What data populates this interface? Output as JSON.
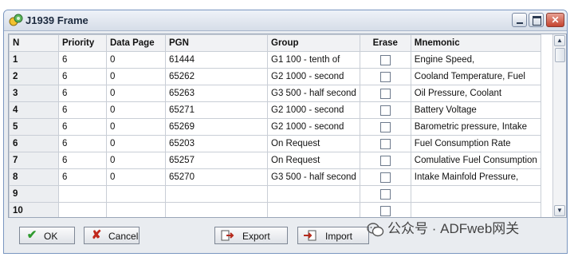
{
  "window": {
    "title": "J1939 Frame",
    "buttons": {
      "minimize": "minimize",
      "maximize": "maximize",
      "close": "✕"
    }
  },
  "grid": {
    "headers": [
      "N",
      "Priority",
      "Data Page",
      "PGN",
      "Group",
      "Erase",
      "Mnemonic"
    ],
    "rows": [
      [
        "1",
        "6",
        "0",
        "61444",
        "G1 100 - tenth of",
        "",
        "Engine Speed,"
      ],
      [
        "2",
        "6",
        "0",
        "65262",
        "G2 1000 - second",
        "",
        "Cooland Temperature, Fuel"
      ],
      [
        "3",
        "6",
        "0",
        "65263",
        "G3 500 - half second",
        "",
        "Oil Pressure, Coolant"
      ],
      [
        "4",
        "6",
        "0",
        "65271",
        "G2 1000 - second",
        "",
        "Battery Voltage"
      ],
      [
        "5",
        "6",
        "0",
        "65269",
        "G2 1000 - second",
        "",
        "Barometric pressure, Intake"
      ],
      [
        "6",
        "6",
        "0",
        "65203",
        "On Request",
        "",
        "Fuel Consumption Rate"
      ],
      [
        "7",
        "6",
        "0",
        "65257",
        "On Request",
        "",
        "Comulative Fuel Consumption"
      ],
      [
        "8",
        "6",
        "0",
        "65270",
        "G3 500 - half second",
        "",
        "Intake Mainfold Pressure,"
      ],
      [
        "9",
        "",
        "",
        "",
        "",
        "",
        ""
      ],
      [
        "10",
        "",
        "",
        "",
        "",
        "",
        ""
      ]
    ],
    "erase_checked": [
      false,
      false,
      false,
      false,
      false,
      false,
      false,
      false,
      false,
      false
    ]
  },
  "buttons": {
    "ok": "OK",
    "cancel": "Cancel",
    "export": "Export",
    "import": "Import"
  },
  "watermark": "公众号 · ADFweb网关",
  "colors": {
    "ok_check": "#2e9a2e",
    "cancel_x": "#c0281c",
    "close_button": "#c4432f"
  }
}
